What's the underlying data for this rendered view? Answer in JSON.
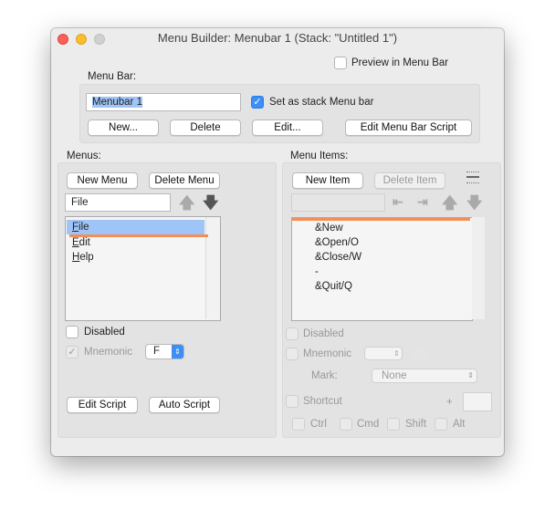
{
  "window": {
    "title": "Menu Builder: Menubar 1 (Stack: \"Untitled 1\")"
  },
  "preview": {
    "label": "Preview in Menu Bar",
    "checked": false
  },
  "menubar": {
    "section_label": "Menu Bar:",
    "name": "Menubar 1",
    "set_stack_label": "Set as stack Menu bar",
    "set_stack_checked": true,
    "new_label": "New...",
    "delete_label": "Delete",
    "edit_label": "Edit...",
    "script_label": "Edit Menu Bar Script"
  },
  "menus": {
    "section_label": "Menus:",
    "new_label": "New Menu",
    "delete_label": "Delete Menu",
    "name_value": "File",
    "items": [
      "File",
      "Edit",
      "Help"
    ],
    "selected": "File",
    "disabled_label": "Disabled",
    "mnemonic_label": "Mnemonic",
    "mnemonic_value": "F",
    "edit_script_label": "Edit Script",
    "auto_script_label": "Auto Script"
  },
  "menu_items": {
    "section_label": "Menu Items:",
    "new_label": "New Item",
    "delete_label": "Delete Item",
    "name_value": "",
    "items": [
      "&New",
      "&Open/O",
      "&Close/W",
      "-",
      "&Quit/Q"
    ],
    "disabled_label": "Disabled",
    "mnemonic_label": "Mnemonic",
    "mark_label": "Mark:",
    "mark_value": "None",
    "shortcut_label": "Shortcut",
    "plus": "+",
    "ctrl": "Ctrl",
    "cmd": "Cmd",
    "shift": "Shift",
    "alt": "Alt"
  },
  "colors": {
    "accent": "#3b8ff6",
    "selection": "#9fc4f7",
    "insert_line": "#f58e55"
  }
}
